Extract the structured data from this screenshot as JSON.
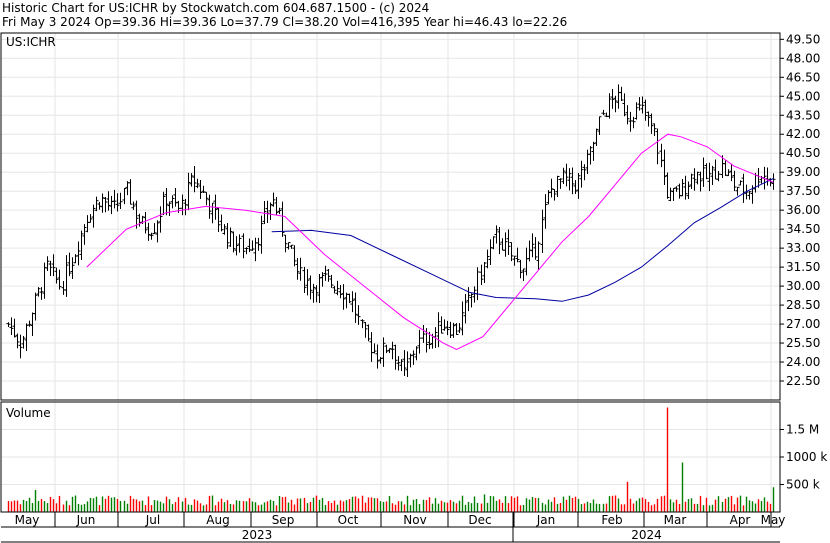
{
  "header": {
    "line1": "Historic Chart for US:ICHR by Stockwatch.com 604.687.1500 - (c) 2024",
    "line2": "Fri May  3 2024  Op=39.36  Hi=39.36  Lo=37.79  Cl=38.20  Vol=416,395  Year hi=46.43  lo=22.26"
  },
  "chart_data": {
    "type": "candlestick",
    "symbol": "US:ICHR",
    "volume_label": "Volume",
    "price_ticks": [
      22.5,
      24.0,
      25.5,
      27.0,
      28.5,
      30.0,
      31.5,
      33.0,
      34.5,
      36.0,
      37.5,
      39.0,
      40.5,
      42.0,
      43.5,
      45.0,
      46.5,
      48.0,
      49.5
    ],
    "price_tick_labels": [
      "22.50",
      "24.00",
      "25.50",
      "27.00",
      "28.50",
      "30.00",
      "31.50",
      "33.00",
      "34.50",
      "36.00",
      "37.50",
      "39.00",
      "40.50",
      "42.00",
      "43.50",
      "45.00",
      "46.50",
      "48.00",
      "49.50"
    ],
    "volume_ticks": [
      500000,
      1000000,
      1500000
    ],
    "volume_tick_labels": [
      "500 k",
      "1000 k",
      "1.5 M"
    ],
    "months": [
      "May",
      "Jun",
      "Jul",
      "Aug",
      "Sep",
      "Oct",
      "Nov",
      "Dec",
      "Jan",
      "Feb",
      "Mar",
      "Apr",
      "May"
    ],
    "years": [
      "2023",
      "2024"
    ],
    "weekly_close": [
      [
        1,
        27.0
      ],
      [
        2,
        25.5
      ],
      [
        3,
        28.5
      ],
      [
        4,
        31.5
      ],
      [
        5,
        30.0
      ],
      [
        6,
        32.5
      ],
      [
        7,
        35.5
      ],
      [
        8,
        37.0
      ],
      [
        9,
        36.0
      ],
      [
        10,
        37.5
      ],
      [
        11,
        35.0
      ],
      [
        12,
        34.5
      ],
      [
        13,
        37.0
      ],
      [
        14,
        36.0
      ],
      [
        15,
        38.5
      ],
      [
        16,
        37.0
      ],
      [
        17,
        35.0
      ],
      [
        18,
        33.5
      ],
      [
        19,
        33.0
      ],
      [
        20,
        34.0
      ],
      [
        21,
        37.0
      ],
      [
        22,
        34.0
      ],
      [
        23,
        31.0
      ],
      [
        24,
        30.0
      ],
      [
        25,
        30.5
      ],
      [
        26,
        30.0
      ],
      [
        27,
        29.0
      ],
      [
        28,
        26.0
      ],
      [
        29,
        24.5
      ],
      [
        30,
        25.5
      ],
      [
        31,
        23.0
      ],
      [
        32,
        25.5
      ],
      [
        33,
        26.0
      ],
      [
        34,
        27.0
      ],
      [
        35,
        26.5
      ],
      [
        36,
        29.0
      ],
      [
        37,
        31.5
      ],
      [
        38,
        34.0
      ],
      [
        39,
        32.5
      ],
      [
        40,
        31.5
      ],
      [
        41,
        33.0
      ],
      [
        42,
        37.5
      ],
      [
        43,
        38.5
      ],
      [
        44,
        38.0
      ],
      [
        45,
        40.0
      ],
      [
        46,
        43.5
      ],
      [
        47,
        45.0
      ],
      [
        48,
        43.5
      ],
      [
        49,
        44.0
      ],
      [
        50,
        42.0
      ],
      [
        51,
        37.0
      ],
      [
        52,
        37.5
      ],
      [
        53,
        39.0
      ],
      [
        54,
        38.5
      ],
      [
        55,
        39.5
      ],
      [
        56,
        38.0
      ],
      [
        57,
        37.5
      ],
      [
        58,
        39.0
      ],
      [
        59,
        38.2
      ]
    ],
    "ma_short": [
      [
        7,
        31.5
      ],
      [
        10,
        34.5
      ],
      [
        13,
        35.8
      ],
      [
        16,
        36.3
      ],
      [
        19,
        36.0
      ],
      [
        22,
        35.5
      ],
      [
        25,
        32.5
      ],
      [
        28,
        30.0
      ],
      [
        31,
        27.5
      ],
      [
        34,
        25.5
      ],
      [
        35,
        25.0
      ],
      [
        37,
        26.0
      ],
      [
        39,
        28.5
      ],
      [
        41,
        31.0
      ],
      [
        43,
        33.5
      ],
      [
        45,
        35.5
      ],
      [
        47,
        38.0
      ],
      [
        49,
        40.5
      ],
      [
        51,
        42.0
      ],
      [
        52,
        41.8
      ],
      [
        54,
        41.0
      ],
      [
        56,
        39.5
      ],
      [
        59,
        38.2
      ]
    ],
    "ma_long": [
      [
        21,
        34.3
      ],
      [
        24,
        34.4
      ],
      [
        27,
        34.0
      ],
      [
        30,
        32.5
      ],
      [
        33,
        31.0
      ],
      [
        36,
        29.5
      ],
      [
        38,
        29.1
      ],
      [
        41,
        29.0
      ],
      [
        43,
        28.8
      ],
      [
        45,
        29.3
      ],
      [
        47,
        30.3
      ],
      [
        49,
        31.5
      ],
      [
        51,
        33.2
      ],
      [
        53,
        35.0
      ],
      [
        55,
        36.2
      ],
      [
        57,
        37.5
      ],
      [
        59,
        38.5
      ]
    ],
    "volume_peaks": [
      [
        3,
        400000
      ],
      [
        6,
        300000
      ],
      [
        13,
        280000
      ],
      [
        24,
        260000
      ],
      [
        29,
        250000
      ],
      [
        37,
        320000
      ],
      [
        43,
        280000
      ],
      [
        47,
        300000
      ],
      [
        48,
        550000
      ],
      [
        51,
        1900000
      ],
      [
        52,
        900000
      ],
      [
        59,
        450000
      ]
    ],
    "colors": {
      "up_bar": "#008000",
      "down_bar": "#ff0000",
      "candle": "#000000",
      "ma_short": "#ff00ff",
      "ma_long": "#0000a0",
      "grid": "#e6e6e6"
    }
  }
}
